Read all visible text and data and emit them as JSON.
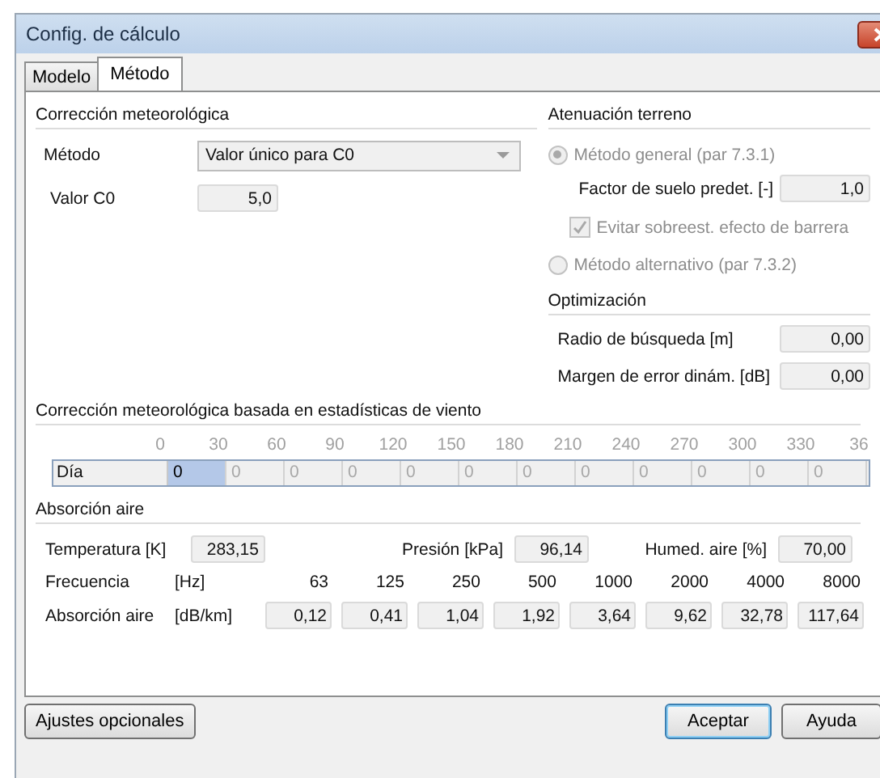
{
  "window": {
    "title": "Config. de cálculo"
  },
  "tabs": [
    {
      "label": "Modelo",
      "selected": false
    },
    {
      "label": "Método",
      "selected": true
    }
  ],
  "meteo": {
    "heading": "Corrección meteorológica",
    "method_label": "Método",
    "method_value": "Valor único para C0",
    "c0_label": "Valor C0",
    "c0_value": "5,0"
  },
  "terrain": {
    "heading": "Atenuación terreno",
    "general": {
      "label": "Método general (par 7.3.1)",
      "selected": true,
      "disabled": true
    },
    "ground_label": "Factor de suelo predet. [-]",
    "ground_value": "1,0",
    "barrier": {
      "label": "Evitar sobreest. efecto de barrera",
      "checked": true,
      "disabled": true
    },
    "alternative": {
      "label": "Método alternativo (par 7.3.2)",
      "selected": false,
      "disabled": true
    }
  },
  "optimization": {
    "heading": "Optimización",
    "fields": [
      {
        "label": "Radio de búsqueda [m]",
        "value": "0,00"
      },
      {
        "label": "Margen de error dinám. [dB]",
        "value": "0,00"
      }
    ]
  },
  "wind": {
    "heading": "Corrección meteorológica basada en estadísticas de viento",
    "angles": [
      "0",
      "30",
      "60",
      "90",
      "120",
      "150",
      "180",
      "210",
      "240",
      "270",
      "300",
      "330",
      "36"
    ],
    "row_label": "Día",
    "cells": [
      {
        "value": "0",
        "selected": true
      },
      {
        "value": "0",
        "selected": false
      },
      {
        "value": "0",
        "selected": false
      },
      {
        "value": "0",
        "selected": false
      },
      {
        "value": "0",
        "selected": false
      },
      {
        "value": "0",
        "selected": false
      },
      {
        "value": "0",
        "selected": false
      },
      {
        "value": "0",
        "selected": false
      },
      {
        "value": "0",
        "selected": false
      },
      {
        "value": "0",
        "selected": false
      },
      {
        "value": "0",
        "selected": false
      },
      {
        "value": "0",
        "selected": false
      }
    ]
  },
  "absorption": {
    "heading": "Absorción aire",
    "temperature": {
      "label": "Temperatura [K]",
      "value": "283,15"
    },
    "pressure": {
      "label": "Presión [kPa]",
      "value": "96,14"
    },
    "humidity": {
      "label": "Humed. aire [%]",
      "value": "70,00"
    },
    "freq_label": "Frecuencia",
    "freq_unit": "[Hz]",
    "frequencies": [
      "63",
      "125",
      "250",
      "500",
      "1000",
      "2000",
      "4000",
      "8000"
    ],
    "abs_label": "Absorción aire",
    "abs_unit": "[dB/km]",
    "values": [
      "0,12",
      "0,41",
      "1,04",
      "1,92",
      "3,64",
      "9,62",
      "32,78",
      "117,64"
    ]
  },
  "buttons": {
    "options": "Ajustes opcionales",
    "ok": "Aceptar",
    "help": "Ayuda"
  }
}
